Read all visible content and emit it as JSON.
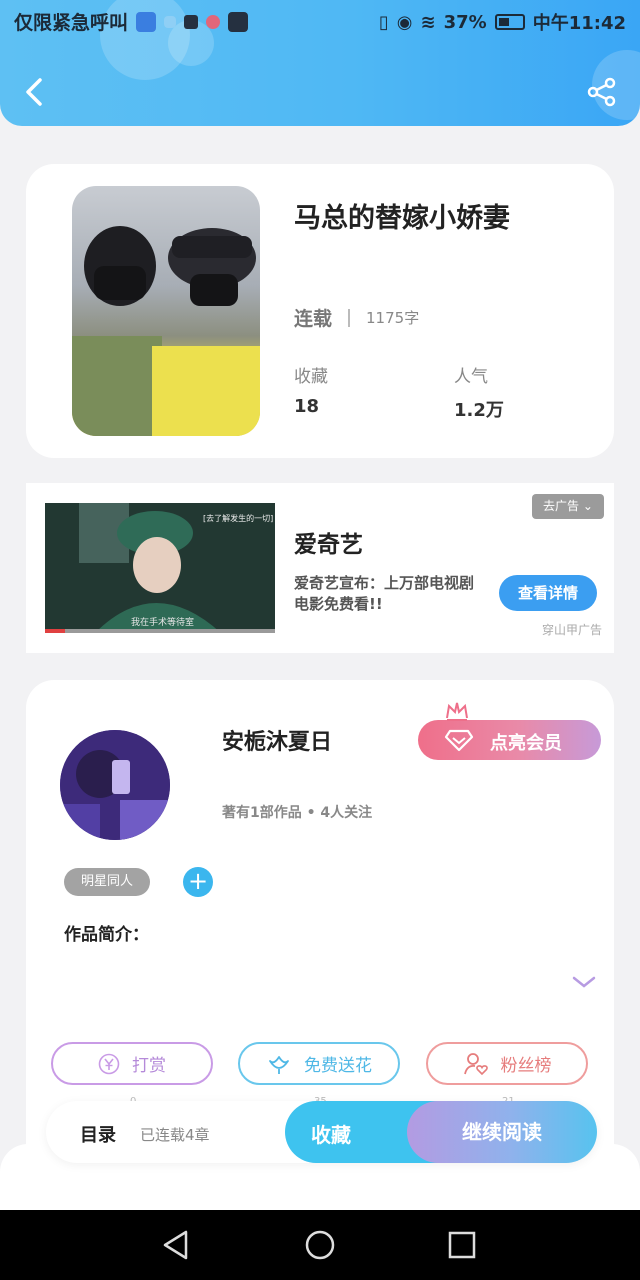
{
  "status_bar": {
    "left_text": "仅限紧急呼叫",
    "battery": "37%",
    "time": "中午11:42"
  },
  "header": {
    "back_icon": "chevron-left-icon",
    "share_icon": "share-icon"
  },
  "book": {
    "title": "马总的替嫁小娇妻",
    "status": "连载",
    "word_count": "1175字",
    "favorites_label": "收藏",
    "favorites_value": "18",
    "popularity_label": "人气",
    "popularity_value": "1.2万"
  },
  "ad": {
    "title": "爱奇艺",
    "description": "爱奇艺宣布：上万部电视剧电影免费看!!",
    "button": "查看详情",
    "remove_label": "去广告",
    "source": "穿山甲广告",
    "thumb_subtitle": "我在手术等待室",
    "thumb_overlay": "[去了解发生的一切]"
  },
  "author": {
    "name": "安栀沐夏日",
    "meta": "著有1部作品 • 4人关注",
    "vip_button": "点亮会员",
    "tag": "明星同人",
    "intro_label": "作品简介："
  },
  "actions": {
    "reward": "打赏",
    "flower": "免费送花",
    "fans": "粉丝榜",
    "reward_count": "0",
    "flower_count": "35",
    "fans_count": "21"
  },
  "bottom": {
    "toc": "目录",
    "toc_sub": "已连载4章",
    "collect": "收藏",
    "continue": "继续阅读"
  },
  "colors": {
    "header": "#4fb8f4",
    "accent": "#3ec3ef",
    "vip_gradient_start": "#ef6f8a"
  }
}
